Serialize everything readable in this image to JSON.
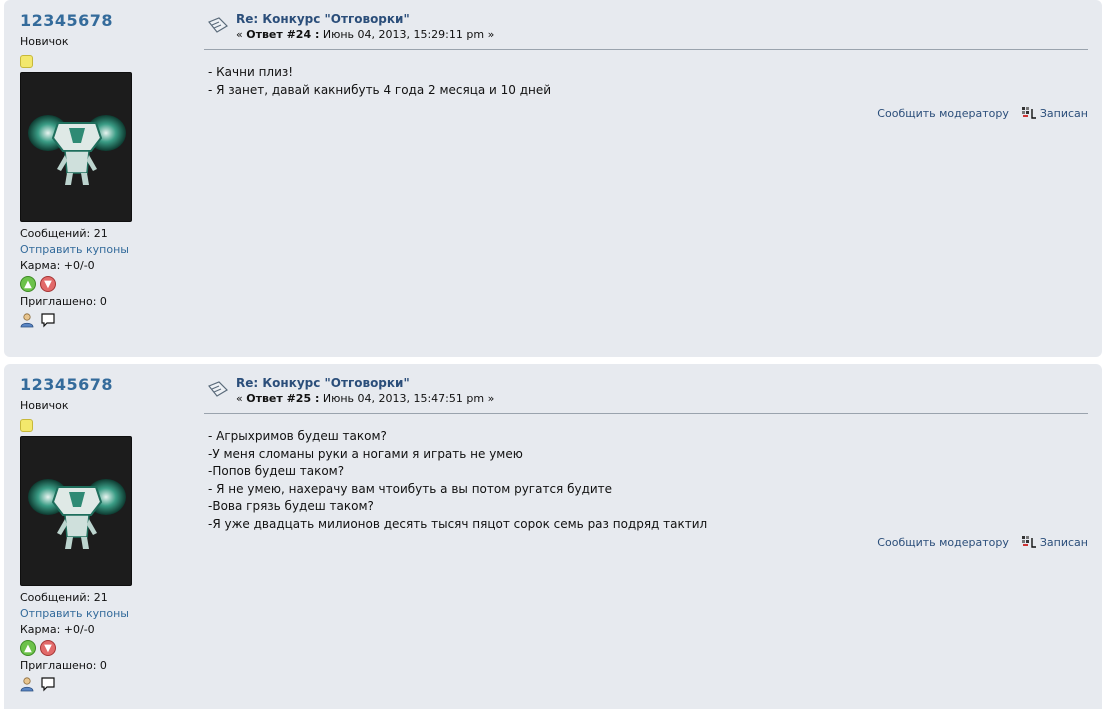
{
  "posts": [
    {
      "poster": {
        "name": "12345678",
        "rank": "Новичок",
        "messages": "Сообщений: 21",
        "send_coupons": "Отправить купоны",
        "karma": "Карма: +0/-0",
        "invited": "Приглашено: 0"
      },
      "subject": "Re: Конкурс \"Отговорки\"",
      "meta_prefix": "« ",
      "reply_label": "Ответ #24 :",
      "date": " Июнь 04, 2013, 15:29:11 pm »",
      "lines": [
        "- Качни плиз!",
        "- Я занет, давай какнибуть 4 года 2 месяца и 10 дней"
      ],
      "report": "Сообщить модератору",
      "logged": "Записан"
    },
    {
      "poster": {
        "name": "12345678",
        "rank": "Новичок",
        "messages": "Сообщений: 21",
        "send_coupons": "Отправить купоны",
        "karma": "Карма: +0/-0",
        "invited": "Приглашено: 0"
      },
      "subject": "Re: Конкурс \"Отговорки\"",
      "meta_prefix": "« ",
      "reply_label": "Ответ #25 :",
      "date": " Июнь 04, 2013, 15:47:51 pm »",
      "lines": [
        "- Агрыхримов будеш таком?",
        "-У меня сломаны руки а ногами я играть не умею",
        "-Попов будеш таком?",
        "- Я не умею, нахерачу вам чтоибуть а вы потом ругатся будите",
        "-Вова грязь будеш таком?",
        "-Я уже двадцать милионов десять тысяч пяцот сорок семь раз подряд тактил"
      ],
      "report": "Сообщить модератору",
      "logged": "Записан"
    }
  ],
  "icons": {
    "message": "message-icon",
    "star": "rank-star-icon",
    "karma_up": "karma-up-icon",
    "karma_down": "karma-down-icon",
    "profile": "profile-icon",
    "pm": "speech-bubble-icon",
    "ip": "ip-logged-icon"
  },
  "colors": {
    "post_bg": "#e7eaef",
    "link": "#346b9b",
    "subject": "#2b4e7a"
  }
}
